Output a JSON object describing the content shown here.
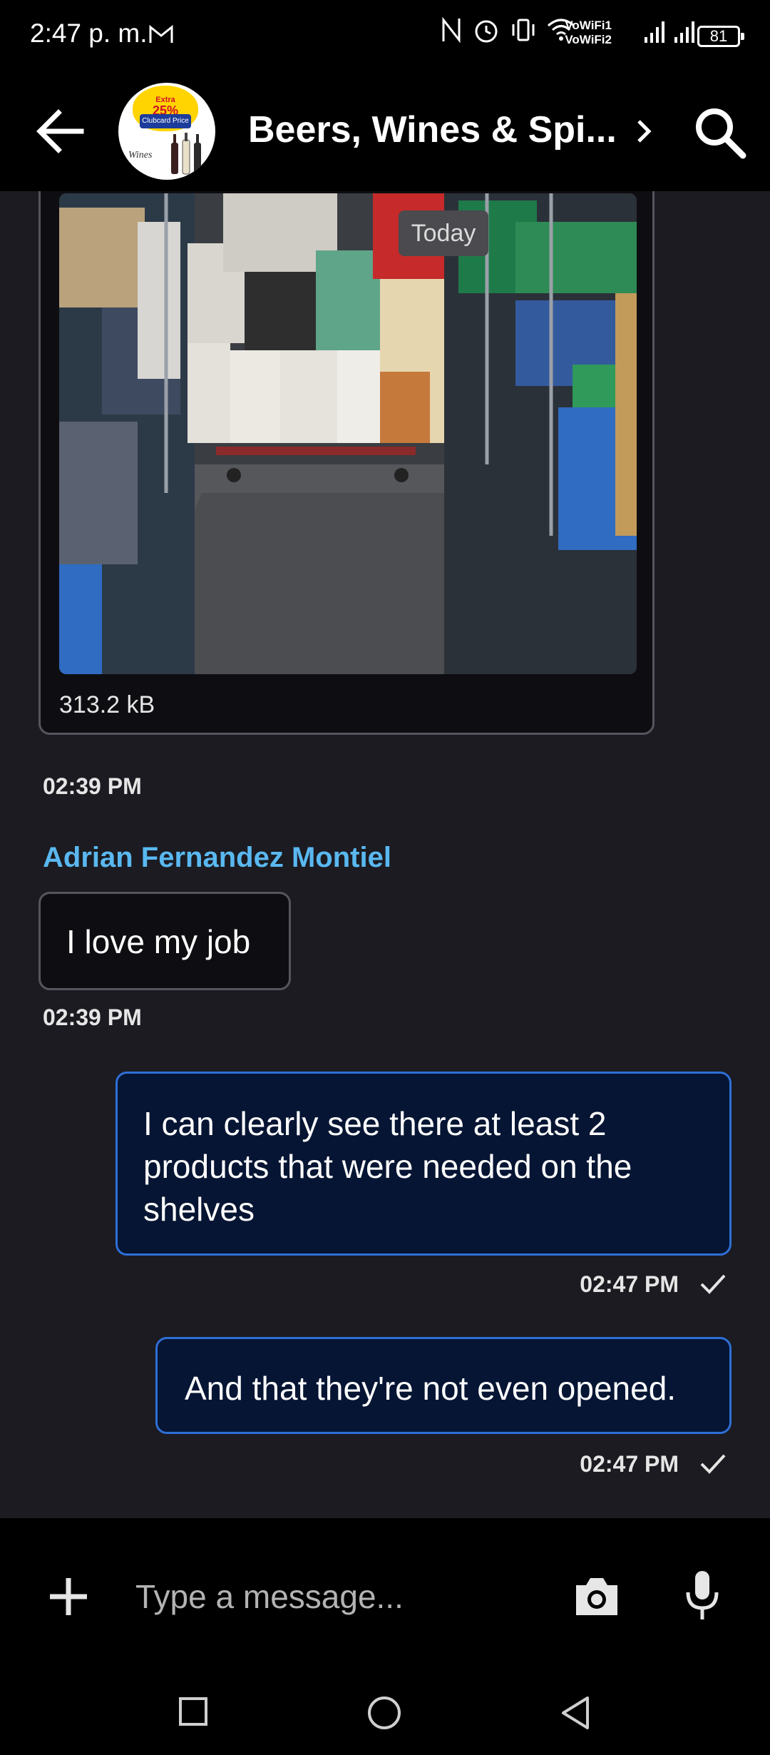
{
  "status_bar": {
    "time": "2:47 p. m.",
    "vowifi_1": "VoWiFi1",
    "vowifi_2": "VoWiFi2",
    "battery": "81"
  },
  "header": {
    "title": "Beers, Wines & Spi...",
    "avatar": {
      "badge_line1": "Extra",
      "badge_line2": "25%",
      "badge_line3": "Clubcard Price",
      "wines_text": "Wines"
    }
  },
  "messages": {
    "image_message": {
      "date_chip": "Today",
      "file_size": "313.2 kB",
      "timestamp": "02:39 PM"
    },
    "incoming": {
      "sender": "Adrian Fernandez Montiel",
      "text": "I love my job",
      "timestamp": "02:39 PM"
    },
    "outgoing": [
      {
        "text": "I can clearly see there at least 2 products that were needed on the shelves",
        "timestamp": "02:47 PM"
      },
      {
        "text": "And that they're not even opened.",
        "timestamp": "02:47 PM"
      }
    ]
  },
  "composer": {
    "placeholder": "Type a message..."
  },
  "colors": {
    "background": "#1b1b21",
    "bar_black": "#000000",
    "sender_name": "#5ab8f0",
    "outgoing_border": "#2f6fd6",
    "outgoing_fill": "#061533",
    "incoming_border": "#55555e"
  },
  "icons": {
    "back": "arrow-left-icon",
    "chevron": "chevron-right-icon",
    "search": "search-icon",
    "plus": "plus-icon",
    "camera": "camera-icon",
    "mic": "microphone-icon",
    "check": "check-icon",
    "nav_recents": "square-icon",
    "nav_home": "circle-icon",
    "nav_back": "triangle-back-icon"
  }
}
